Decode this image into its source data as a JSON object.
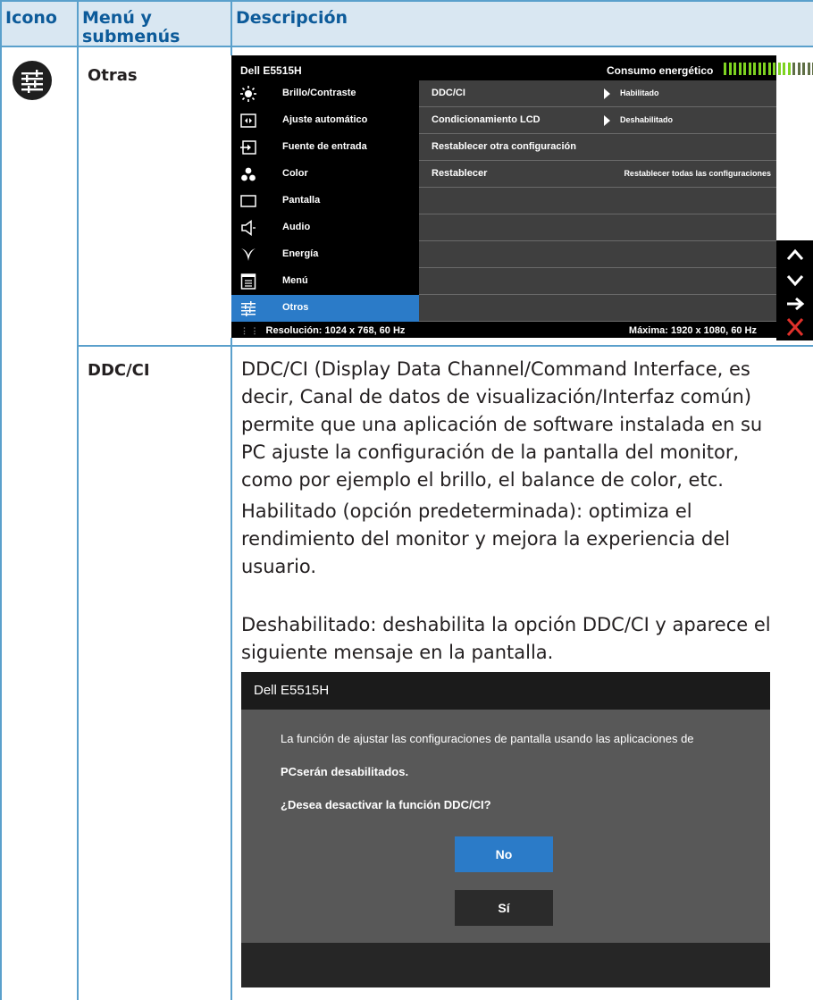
{
  "table": {
    "headers": {
      "icon": "Icono",
      "menu": "Menú y submenús",
      "menu_line1": "Menú y",
      "menu_line2": "submenús",
      "description": "Descripción"
    },
    "category": "Otras",
    "category_icon": "sliders-icon",
    "line_color": "#5aa0cc",
    "header_text_color": "#0d5b9a"
  },
  "osd": {
    "model": "Dell E5515H",
    "energy_label": "Consumo energético",
    "energy_level": 0.72,
    "menu_items": [
      {
        "label": "Brillo/Contraste",
        "icon": "brightness-icon"
      },
      {
        "label": "Ajuste automático",
        "icon": "auto-adjust-icon"
      },
      {
        "label": "Fuente de entrada",
        "icon": "input-source-icon"
      },
      {
        "label": "Color",
        "icon": "color-icon"
      },
      {
        "label": "Pantalla",
        "icon": "display-icon"
      },
      {
        "label": "Audio",
        "icon": "speaker-icon"
      },
      {
        "label": "Energía",
        "icon": "energy-icon"
      },
      {
        "label": "Menú",
        "icon": "menu-icon"
      },
      {
        "label": "Otros",
        "icon": "sliders-icon"
      }
    ],
    "selected_index": 8,
    "rows": [
      {
        "label": "DDC/CI",
        "value": "Habilitado"
      },
      {
        "label": "Condicionamiento LCD",
        "value": "Deshabilitado"
      },
      {
        "label": "Restablecer otra configuración",
        "value": ""
      },
      {
        "label": "Restablecer",
        "value": "Restablecer todas las configuraciones"
      }
    ],
    "resolution": "Resolución: 1024 x 768, 60 Hz",
    "max_resolution": "Máxima: 1920 x 1080, 60 Hz",
    "accent_color": "#2b7bc8"
  },
  "nav_buttons": [
    {
      "icon": "chevron-up-icon"
    },
    {
      "icon": "chevron-down-icon"
    },
    {
      "icon": "arrow-right-icon"
    },
    {
      "icon": "close-icon",
      "color": "#e0312b"
    }
  ],
  "ddcci": {
    "title": "DDC/CI",
    "paragraph1_lines": [
      "DDC/CI (Display Data Channel/Command Interface, es",
      "decir, Canal de datos de visualización/Interfaz común)",
      "permite que una aplicación de software instalada en su",
      "PC ajuste la configuración de la pantalla del monitor,",
      "como por ejemplo el brillo, el balance de color, etc."
    ],
    "paragraph2_lines": [
      "Habilitado (opción predeterminada): optimiza el",
      "rendimiento del monitor y mejora la experiencia del",
      "usuario."
    ],
    "paragraph3_lines": [
      "Deshabilitado: deshabilita la opción DDC/CI y aparece el",
      "siguiente mensaje en la pantalla."
    ]
  },
  "dialog": {
    "title": "Dell E5515H",
    "message_line1": "La función de ajustar las configuraciones de pantalla usando las aplicaciones de",
    "message_line2": "PCserán desabilitados.",
    "question": "¿Desea desactivar la función DDC/CI?",
    "button_no": "No",
    "button_yes": "Sí"
  }
}
